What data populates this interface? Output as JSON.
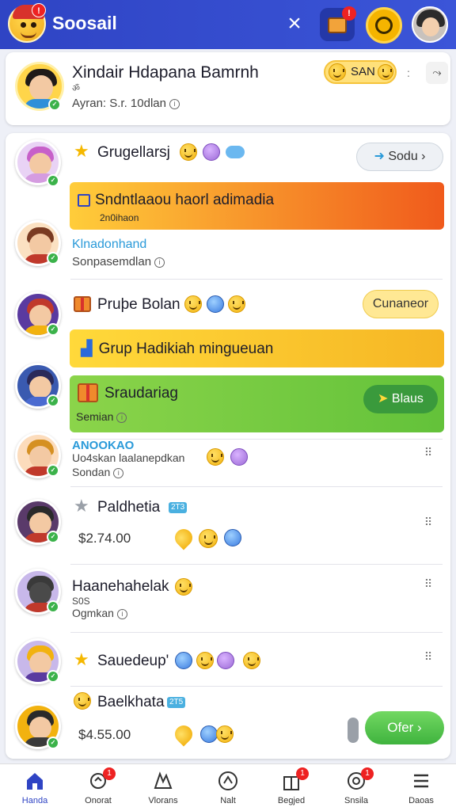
{
  "header": {
    "app_title": "Soosail",
    "logo_badge": "!",
    "chest_badge": "!"
  },
  "profile": {
    "name": "Xindair Hdapana Bamrnh",
    "sub": "ॐ",
    "meta": "Ayran: S.r. 10dlan",
    "coin_label": "SAN"
  },
  "feed": [
    {
      "title": "Grugellarsj",
      "button": "Sodu"
    },
    {
      "banner_title": "Sndntlaaou haorl adimadia",
      "banner_sub": "2n0ihaon"
    },
    {
      "tag": "Klnadonhand",
      "sub": "Sonpasemdlan"
    },
    {
      "title": "Pruþe Bolan",
      "button": "Cunaneor"
    },
    {
      "banner_title": "Grup Hadikiah mingueuan"
    },
    {
      "banner_title": "Sraudariag",
      "banner_sub": "Semian",
      "button": "Blaus"
    },
    {
      "tag": "ANOOKAO",
      "title": "Uo4skan laalanepdkan",
      "sub": "Sondan"
    },
    {
      "title": "Paldhetia",
      "tag_mini": "2T3",
      "price": "$2.74.00"
    },
    {
      "title": "Haanehahelak",
      "small": "S0S",
      "sub": "Ogmkan"
    },
    {
      "title": "Sauedeup'"
    },
    {
      "title": "Baelkhata",
      "tag_mini": "2T5",
      "price": "$4.55.00",
      "button": "Ofer"
    }
  ],
  "nav": [
    {
      "label": "Handa",
      "icon": "home-icon",
      "badge": ""
    },
    {
      "label": "Onorat",
      "icon": "bell-icon",
      "badge": "1"
    },
    {
      "label": "Vlorans",
      "icon": "map-icon",
      "badge": ""
    },
    {
      "label": "Nalt",
      "icon": "compass-icon",
      "badge": ""
    },
    {
      "label": "Begjed",
      "icon": "gift-icon",
      "badge": "1"
    },
    {
      "label": "Snsila",
      "icon": "chat-icon",
      "badge": "1"
    },
    {
      "label": "Daoas",
      "icon": "menu-icon",
      "badge": ""
    }
  ],
  "colors": {
    "brand": "#2f44c4",
    "accent_orange": "#f05a1c",
    "accent_green": "#63c23a",
    "accent_yellow": "#ffd93a",
    "online": "#3bb24a"
  }
}
